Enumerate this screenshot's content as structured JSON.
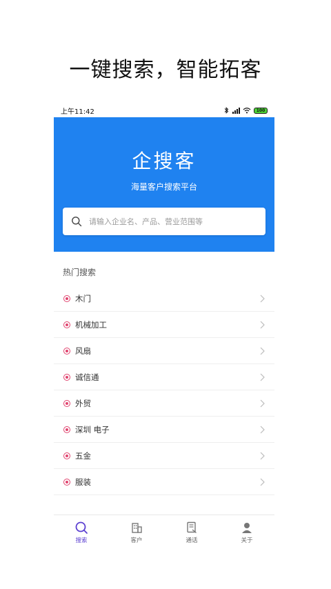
{
  "promo": {
    "title": "一键搜索，智能拓客"
  },
  "status_bar": {
    "time": "上午11:42",
    "battery": "100"
  },
  "header": {
    "app_name": "企搜客",
    "slogan": "海量客户搜索平台"
  },
  "search": {
    "placeholder": "请输入企业名、产品、营业范围等",
    "value": ""
  },
  "hot_search": {
    "title": "热门搜索",
    "items": [
      {
        "label": "木门"
      },
      {
        "label": "机械加工"
      },
      {
        "label": "风扇"
      },
      {
        "label": "诚信通"
      },
      {
        "label": "外贸"
      },
      {
        "label": "深圳 电子"
      },
      {
        "label": "五金"
      },
      {
        "label": "服装"
      }
    ]
  },
  "tab_bar": {
    "tabs": [
      {
        "label": "搜索",
        "icon": "search-icon",
        "active": true
      },
      {
        "label": "客户",
        "icon": "building-icon",
        "active": false
      },
      {
        "label": "通话",
        "icon": "call-log-icon",
        "active": false
      },
      {
        "label": "关于",
        "icon": "user-icon",
        "active": false
      }
    ]
  },
  "colors": {
    "primary": "#1f82f0",
    "dot": "#e0436e",
    "active_tab": "#5b3fd1"
  }
}
